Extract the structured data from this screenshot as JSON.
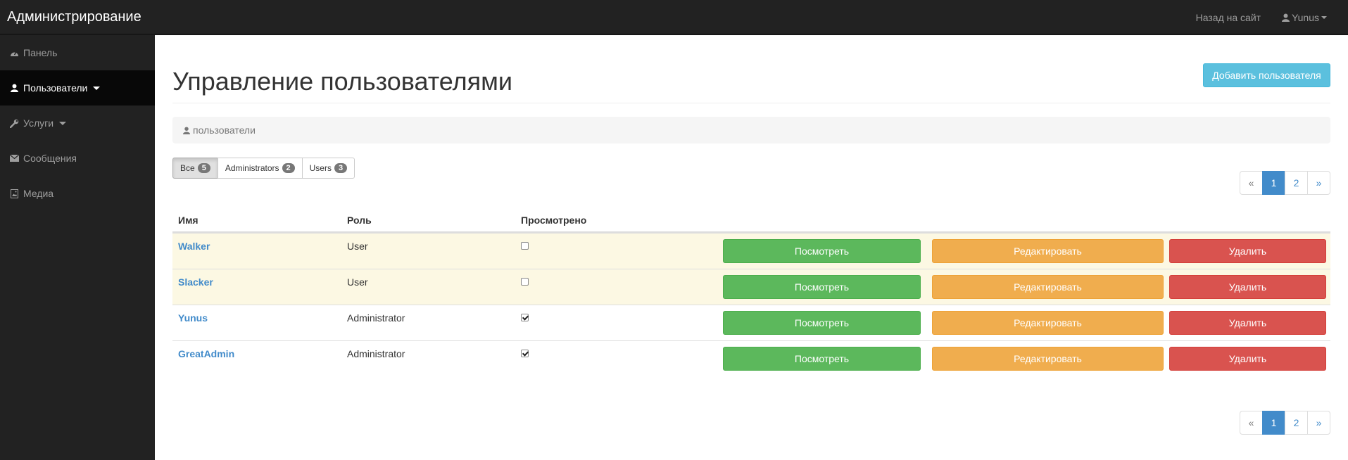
{
  "topbar": {
    "brand": "Администрирование",
    "back_link": "Назад на сайт",
    "user_menu": "Yunus"
  },
  "sidebar": {
    "items": [
      {
        "label": "Панель",
        "icon": "dashboard-icon"
      },
      {
        "label": "Пользователи",
        "icon": "user-icon",
        "active": true
      },
      {
        "label": "Услуги",
        "icon": "wrench-icon"
      },
      {
        "label": "Сообщения",
        "icon": "envelope-icon"
      },
      {
        "label": "Медиа",
        "icon": "image-file-icon"
      }
    ]
  },
  "page": {
    "title": "Управление пользователями",
    "add_button": "Добавить пользователя",
    "breadcrumb": "пользователи"
  },
  "filters": [
    {
      "label": "Все",
      "count": "5",
      "active": true
    },
    {
      "label": "Administrators",
      "count": "2"
    },
    {
      "label": "Users",
      "count": "3"
    }
  ],
  "pagination": {
    "prev": "«",
    "pages": [
      "1",
      "2"
    ],
    "current": "1",
    "next": "»"
  },
  "table": {
    "headers": [
      "Имя",
      "Роль",
      "Просмотрено"
    ],
    "rows": [
      {
        "name": "Walker",
        "role": "User",
        "seen": false
      },
      {
        "name": "Slacker",
        "role": "User",
        "seen": false
      },
      {
        "name": "Yunus",
        "role": "Administrator",
        "seen": true
      },
      {
        "name": "GreatAdmin",
        "role": "Administrator",
        "seen": true
      }
    ],
    "actions": {
      "view": "Посмотреть",
      "edit": "Редактировать",
      "delete": "Удалить"
    }
  },
  "colors": {
    "navbar": "#222222",
    "primary": "#428bca",
    "success": "#5cb85c",
    "warning": "#f0ad4e",
    "danger": "#d9534f",
    "info": "#5bc0de",
    "row_highlight": "#fcf8e3"
  }
}
